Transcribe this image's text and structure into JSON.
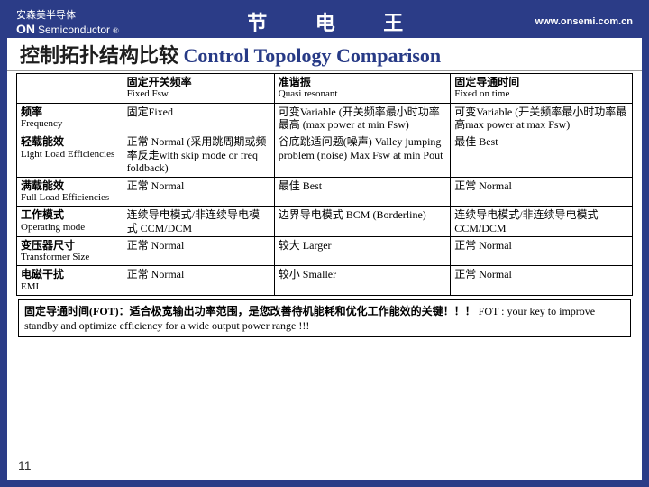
{
  "top": {
    "logo_cn": "安森美半导体",
    "logo_on": "ON",
    "logo_semi": "Semiconductor",
    "logo_r": "®",
    "center": "节 电 王",
    "url": "www.onsemi.com.cn"
  },
  "title": {
    "cn": "控制拓扑结构比较",
    "en": "Control Topology Comparison"
  },
  "table": {
    "head": {
      "c0": "",
      "c1_cn": "固定开关频率",
      "c1_en": "Fixed Fsw",
      "c2_cn": "准谐振",
      "c2_en": "Quasi resonant",
      "c3_cn": "固定导通时间",
      "c3_en": "Fixed on time"
    },
    "rows": [
      {
        "label_cn": "频率",
        "label_en": "Frequency",
        "c1": "固定Fixed",
        "c2": "可变Variable (开关频率最小时功率最高 (max power at min Fsw)",
        "c3": "可变Variable (开关频率最小时功率最高max power at max Fsw)"
      },
      {
        "label_cn": "轻载能效",
        "label_en": "Light Load Efficiencies",
        "c1": "正常 Normal (采用跳周期或频率反走with skip mode or freq foldback)",
        "c2": "谷底跳适问题(噪声) Valley jumping problem (noise) Max Fsw at min Pout",
        "c3": "最佳 Best"
      },
      {
        "label_cn": "满载能效",
        "label_en": "Full Load Efficiencies",
        "c1": "正常 Normal",
        "c2": "最佳 Best",
        "c3": "正常 Normal"
      },
      {
        "label_cn": "工作模式",
        "label_en": "Operating mode",
        "c1": "连续导电模式/非连续导电模式 CCM/DCM",
        "c2": "边界导电模式 BCM (Borderline)",
        "c3": "连续导电模式/非连续导电模式CCM/DCM"
      },
      {
        "label_cn": "变压器尺寸",
        "label_en": "Transformer Size",
        "c1": "正常 Normal",
        "c2": "较大 Larger",
        "c3": "正常 Normal"
      },
      {
        "label_cn": "电磁干扰",
        "label_en": "EMI",
        "c1": "正常 Normal",
        "c2": "较小 Smaller",
        "c3": "正常 Normal"
      }
    ]
  },
  "footnote": {
    "cn": "固定导通时间(FOT)：适合极宽输出功率范围，是您改善待机能耗和优化工作能效的关键！！！",
    "en": "FOT : your key to improve standby and optimize efficiency for a wide output power range !!!"
  },
  "pagenum": "11"
}
